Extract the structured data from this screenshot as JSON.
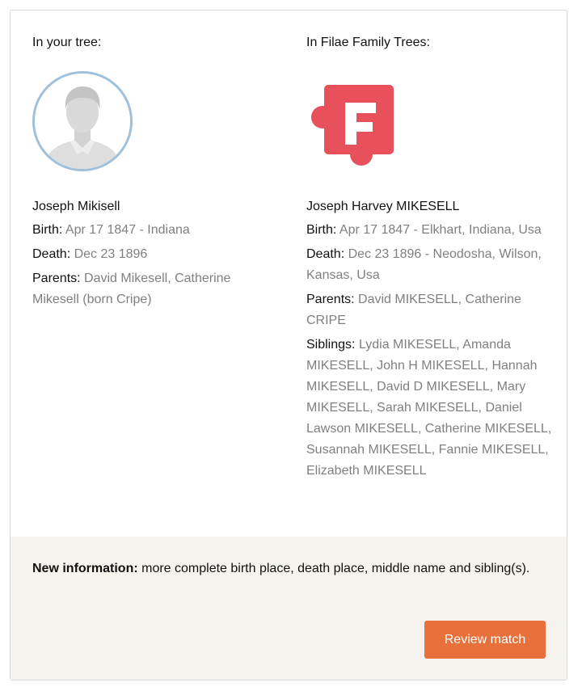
{
  "left": {
    "heading": "In your tree:",
    "avatar_icon": "default-male-avatar-icon",
    "name": "Joseph Mikisell",
    "facts": {
      "birth_label": "Birth:",
      "birth_value": "Apr 17 1847 - Indiana",
      "death_label": "Death:",
      "death_value": "Dec 23 1896",
      "parents_label": "Parents:",
      "parents_value": "David Mikesell, Catherine Mikesell (born Cripe)"
    }
  },
  "right": {
    "heading": "In Filae Family Trees:",
    "logo_icon": "filae-puzzle-logo-icon",
    "name": "Joseph Harvey MIKESELL",
    "facts": {
      "birth_label": "Birth:",
      "birth_value": "Apr 17 1847 - Elkhart, Indiana, Usa",
      "death_label": "Death:",
      "death_value": "Dec 23 1896 - Neodosha, Wilson, Kansas, Usa",
      "parents_label": "Parents:",
      "parents_value": "David MIKESELL, Catherine CRIPE",
      "siblings_label": "Siblings:",
      "siblings_value": "Lydia MIKESELL, Amanda MIKESELL, John H MIKESELL, Hannah MIKESELL, David D MIKESELL, Mary MIKESELL, Sarah MIKESELL, Daniel Lawson MIKESELL, Catherine MIKESELL, Susannah MIKESELL, Fannie MIKESELL, Elizabeth MIKESELL"
    }
  },
  "footer": {
    "new_info_label": "New information:",
    "new_info_text": "more complete birth place, death place, middle name and sibling(s).",
    "review_button": "Review match"
  },
  "colors": {
    "accent_button": "#e8703a",
    "filae_brand": "#e8505b",
    "avatar_ring": "#9fc0da",
    "footer_bg": "#f6f3ee",
    "value_text": "#808080"
  }
}
